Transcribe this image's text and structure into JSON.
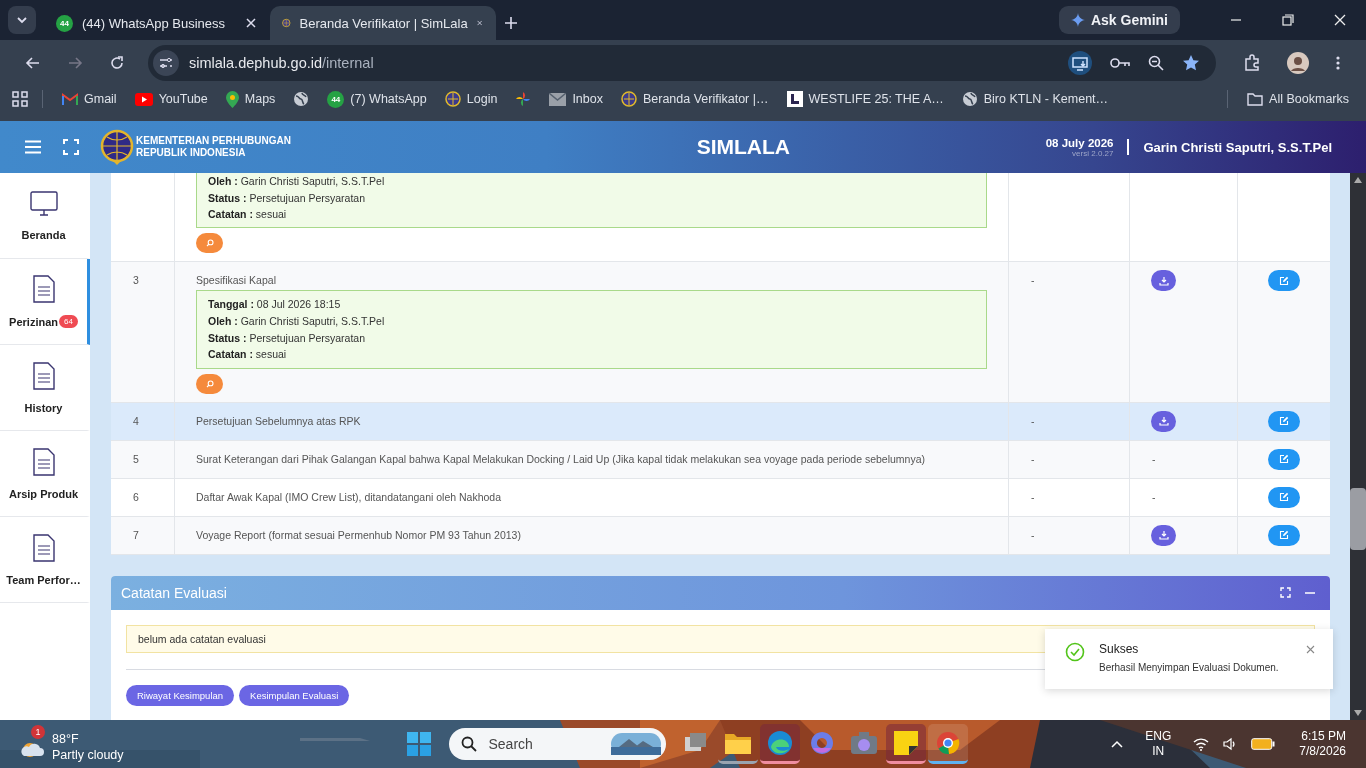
{
  "browser": {
    "tabs": [
      {
        "title": "(44) WhatsApp Business",
        "kind": "whatsapp",
        "badge": "44",
        "selected": false
      },
      {
        "title": "Beranda Verifikator | SimLala",
        "kind": "emblem",
        "selected": true
      }
    ],
    "ask_gemini": "Ask Gemini",
    "url_host": "simlala.dephub.go.id",
    "url_path": "/internal",
    "bookmarks": [
      {
        "label": "Gmail",
        "kind": "gmail"
      },
      {
        "label": "YouTube",
        "kind": "youtube"
      },
      {
        "label": "Maps",
        "kind": "maps"
      },
      {
        "kind": "globe"
      },
      {
        "label": "(7) WhatsApp",
        "kind": "whatsapp",
        "badge": "44"
      },
      {
        "label": "Login",
        "kind": "emblem"
      },
      {
        "kind": "pinwheel"
      },
      {
        "label": "Inbox",
        "kind": "mail"
      },
      {
        "label": "Beranda Verifikator |…",
        "kind": "emblem"
      },
      {
        "label": "WESTLIFE 25: THE A…",
        "kind": "square"
      },
      {
        "label": "Biro KTLN - Kement…",
        "kind": "globe"
      }
    ],
    "all_bookmarks": "All Bookmarks"
  },
  "header": {
    "org_line1": "KEMENTERIAN PERHUBUNGAN",
    "org_line2": "REPUBLIK INDONESIA",
    "app_name": "SIMLALA",
    "date": "08 July 2026",
    "version": "versi 2.0.27",
    "user": "Garin Christi Saputri, S.S.T.Pel"
  },
  "sidebar": {
    "items": [
      {
        "label": "Beranda",
        "kind": "monitor",
        "selected": false
      },
      {
        "label": "Perizinan",
        "kind": "document",
        "badge": "64",
        "selected": true
      },
      {
        "label": "History",
        "kind": "document",
        "selected": false
      },
      {
        "label": "Arsip Produk",
        "kind": "document",
        "selected": false
      },
      {
        "label": "Team Perfor…",
        "kind": "document",
        "selected": false
      }
    ]
  },
  "documents": {
    "rows": [
      {
        "note": [
          {
            "label": "Oleh :",
            "value": "Garin Christi Saputri, S.S.T.Pel"
          },
          {
            "label": "Status :",
            "value": "Persetujuan Persyaratan"
          },
          {
            "label": "Catatan :",
            "value": "sesuai"
          }
        ],
        "highlighted": false,
        "file": {
          "kind": "none"
        },
        "action": {
          "kind": "none"
        }
      },
      {
        "no": "3",
        "title": "Spesifikasi Kapal",
        "note": [
          {
            "label": "Tanggal :",
            "value": "08 Jul 2026 18:15"
          },
          {
            "label": "Oleh :",
            "value": "Garin Christi Saputri, S.S.T.Pel"
          },
          {
            "label": "Status :",
            "value": "Persetujuan Persyaratan"
          },
          {
            "label": "Catatan :",
            "value": "sesuai"
          }
        ],
        "column_3": "-",
        "highlighted": false,
        "file": {
          "kind": "download"
        },
        "action": {
          "kind": "edit"
        }
      },
      {
        "no": "4",
        "title": "Persetujuan Sebelumnya atas RPK",
        "column_3": "-",
        "highlighted": true,
        "file": {
          "kind": "download"
        },
        "action": {
          "kind": "edit"
        }
      },
      {
        "no": "5",
        "title": "Surat Keterangan dari Pihak Galangan Kapal bahwa Kapal Melakukan Docking / Laid Up (Jika kapal tidak melakukan sea voyage pada periode sebelumnya)",
        "column_3": "-",
        "highlighted": false,
        "file": {
          "kind": "text",
          "text": "-"
        },
        "action": {
          "kind": "edit"
        }
      },
      {
        "no": "6",
        "title": "Daftar Awak Kapal (IMO Crew List), ditandatangani oleh Nakhoda",
        "column_3": "-",
        "highlighted": false,
        "file": {
          "kind": "text",
          "text": "-"
        },
        "action": {
          "kind": "edit"
        }
      },
      {
        "no": "7",
        "title": "Voyage Report (format sesuai Permenhub Nomor PM 93 Tahun 2013)",
        "column_3": "-",
        "highlighted": false,
        "file": {
          "kind": "download"
        },
        "action": {
          "kind": "edit"
        }
      }
    ]
  },
  "evaluation_panel": {
    "title": "Catatan Evaluasi",
    "note": "belum ada catatan evaluasi",
    "buttons": [
      "Riwayat Kesimpulan",
      "Kesimpulan Evaluasi"
    ]
  },
  "toast": {
    "title": "Sukses",
    "message": "Berhasil Menyimpan Evaluasi Dokumen."
  },
  "taskbar": {
    "weather": {
      "temp": "88°F",
      "condition": "Partly cloudy",
      "badge": "1"
    },
    "search_placeholder": "Search",
    "apps": [
      {
        "kind": "files",
        "open": false,
        "flashing": false,
        "selected": false
      },
      {
        "kind": "folder",
        "open": true,
        "flashing": false,
        "selected": false
      },
      {
        "kind": "edge",
        "open": true,
        "flashing": true,
        "selected": false
      },
      {
        "kind": "copilot",
        "open": false,
        "flashing": false,
        "selected": false
      },
      {
        "kind": "camera",
        "open": false,
        "flashing": false,
        "selected": false
      },
      {
        "kind": "sticky",
        "open": true,
        "flashing": true,
        "selected": false
      },
      {
        "kind": "chrome",
        "open": true,
        "flashing": false,
        "selected": true
      }
    ],
    "language": "ENG",
    "region": "IN",
    "time": "6:15 PM",
    "date": "7/8/2026"
  }
}
